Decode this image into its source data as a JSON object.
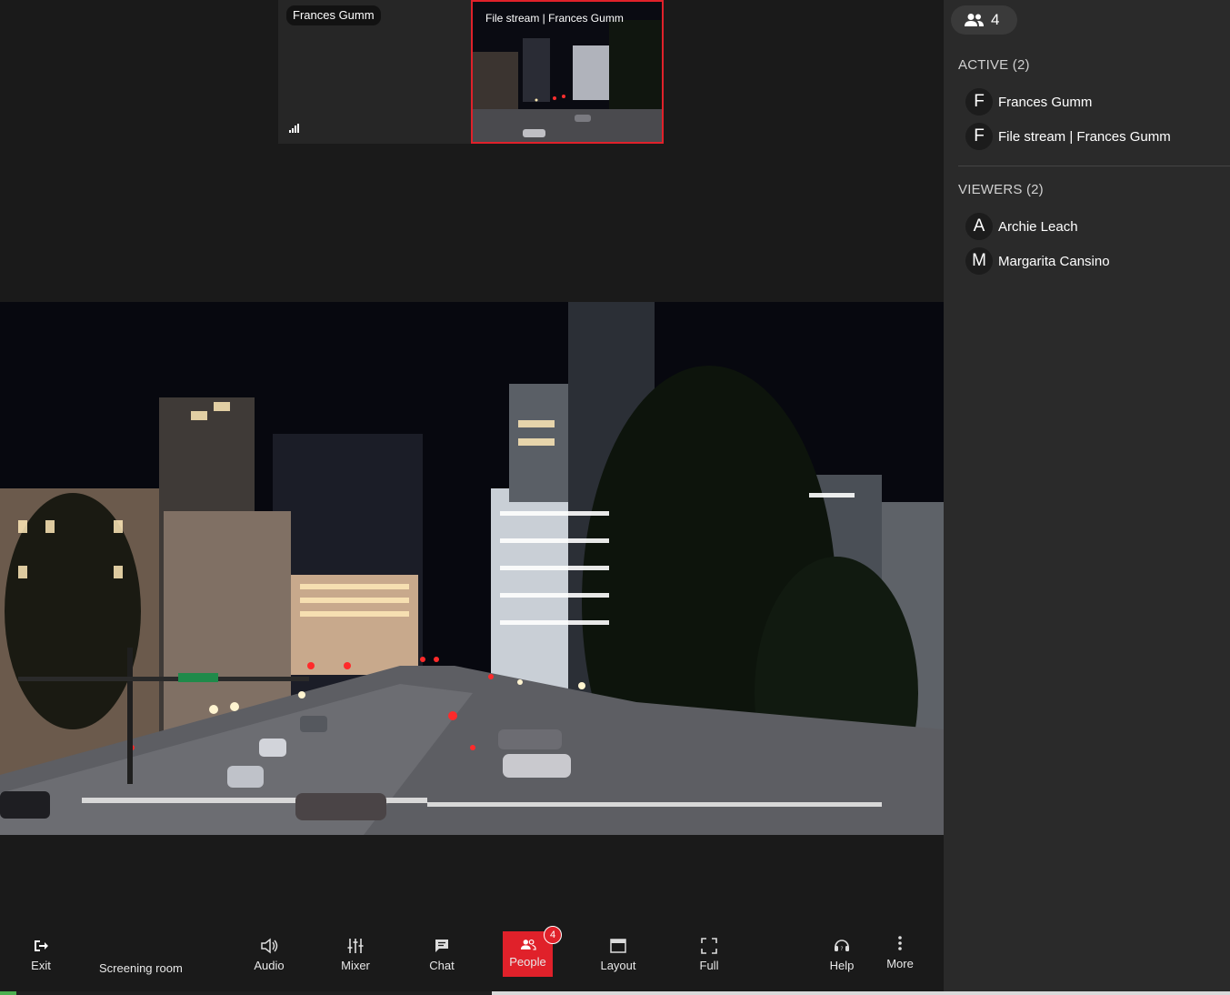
{
  "stage": {
    "tiles": [
      {
        "label": "Frances Gumm"
      },
      {
        "label": "File stream | Frances Gumm"
      }
    ]
  },
  "toolbar": {
    "exit_label": "Exit",
    "room_name": "Screening room",
    "audio_label": "Audio",
    "mixer_label": "Mixer",
    "chat_label": "Chat",
    "people_label": "People",
    "people_badge": "4",
    "layout_label": "Layout",
    "full_label": "Full",
    "help_label": "Help",
    "more_label": "More",
    "accent_color": "#e0212a"
  },
  "panel": {
    "participant_count": "4",
    "active_title": "ACTIVE (2)",
    "active": [
      {
        "initial": "F",
        "name": "Frances Gumm"
      },
      {
        "initial": "F",
        "name": "File stream | Frances Gumm"
      }
    ],
    "viewers_title": "VIEWERS (2)",
    "viewers": [
      {
        "initial": "A",
        "name": "Archie Leach"
      },
      {
        "initial": "M",
        "name": "Margarita Cansino"
      }
    ]
  }
}
